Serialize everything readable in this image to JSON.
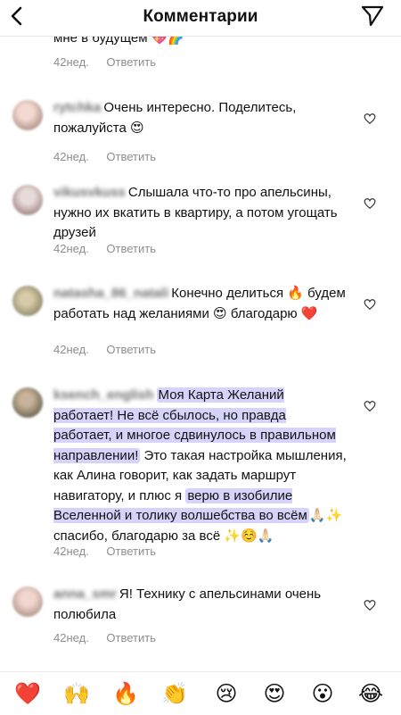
{
  "header": {
    "title": "Комментарии"
  },
  "top_partial": {
    "text": "мне в будущем 💖🌈",
    "time": "42нед.",
    "reply": "Ответить"
  },
  "comments": [
    {
      "username": "rytchka",
      "text": "Очень интересно. Поделитесь, пожалуйста 😍",
      "time": "42нед.",
      "reply": "Ответить"
    },
    {
      "username": "vikusvkuss",
      "text": "Слышала что-то про апельсины, нужно их вкатить в квартиру, а потом угощать друзей",
      "time": "42нед.",
      "reply": "Ответить"
    },
    {
      "username": "natasha_86_natali",
      "text": "Конечно делиться 🔥 будем работать над желаниями 😍 благодарю ❤️",
      "time": "42нед.",
      "reply": "Ответить"
    },
    {
      "username": "ksench_english",
      "text_hl1": "Моя Карта Желаний работает! Не всё сбылось, но правда работает, и многое сдвинулось в правильном направлении!",
      "text_plain1": " Это такая настройка мышления, как Алина говорит, как задать маршрут навигатору, и плюс я ",
      "text_hl2": "верю в изобилие Вселенной и толику волшебства во всём",
      "text_plain2": "🙏🏻✨ спасибо, благодарю за всё ✨☺️🙏🏻",
      "time": "42нед.",
      "reply": "Ответить"
    },
    {
      "username": "anna_smr",
      "text": "Я! Технику с апельсинами очень полюбила",
      "time": "42нед.",
      "reply": "Ответить"
    }
  ],
  "reactions": [
    "❤️",
    "🙌",
    "🔥",
    "👏",
    "😢",
    "😍",
    "😮",
    "😂"
  ],
  "colors": {
    "highlight": "#d6d3fa",
    "muted": "#8e8e8e",
    "heart_red": "#e0245e"
  },
  "icons": {
    "back": "chevron-left-icon",
    "send": "paper-plane-icon",
    "like": "heart-outline-icon"
  }
}
